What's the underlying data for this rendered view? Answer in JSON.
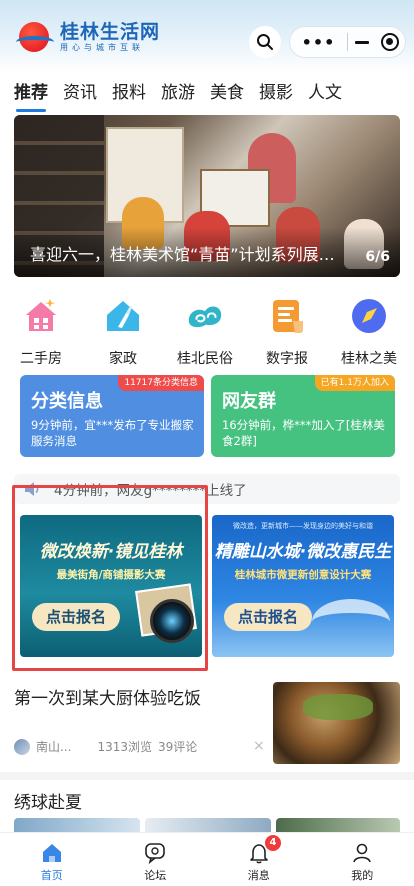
{
  "header": {
    "logo_title": "桂林生活网",
    "logo_subtitle": "用心与城市互联",
    "capsule_more": "•••"
  },
  "tabs": [
    {
      "label": "推荐",
      "active": true
    },
    {
      "label": "资讯"
    },
    {
      "label": "报料"
    },
    {
      "label": "旅游"
    },
    {
      "label": "美食"
    },
    {
      "label": "摄影"
    },
    {
      "label": "人文"
    }
  ],
  "banner": {
    "caption": "喜迎六一，桂林美术馆“青苗”计划系列展…",
    "counter": "6/6"
  },
  "categories": [
    {
      "label": "二手房",
      "icon": "house-icon",
      "color": "#f46aa0"
    },
    {
      "label": "家政",
      "icon": "broom-icon",
      "color": "#3bb6e8"
    },
    {
      "label": "桂北民俗",
      "icon": "cloud-pattern-icon",
      "color": "#2bb3c9"
    },
    {
      "label": "数字报",
      "icon": "newspaper-icon",
      "color": "#f0902a"
    },
    {
      "label": "桂林之美",
      "icon": "compass-icon",
      "color": "#4f6cf0"
    }
  ],
  "cards": {
    "classified": {
      "title": "分类信息",
      "tag": "11717条分类信息",
      "desc": "9分钟前，宜***发布了专业搬家服务消息"
    },
    "group": {
      "title": "网友群",
      "tag": "已有1.1万人加入",
      "desc": "16分钟前，桦***加入了[桂林美食2群]"
    }
  },
  "notice": {
    "text": "4分钟前，网友g********上线了"
  },
  "promos": [
    {
      "title": "微改焕新·镜见桂林",
      "subtitle": "最美街角/商铺摄影大赛",
      "button": "点击报名"
    },
    {
      "top_text": "微改造，更新城市——发现身边的美好与和谐",
      "title": "精雕山水城·微改惠民生",
      "subtitle": "桂林城市微更新创意设计大赛",
      "button": "点击报名"
    }
  ],
  "article": {
    "title": "第一次到某大厨体验吃饭",
    "source": "南山...",
    "views": "1313浏览",
    "comments": "39评论",
    "close": "×"
  },
  "section": {
    "title": "绣球赴夏"
  },
  "tabbar": [
    {
      "label": "首页",
      "icon": "home-icon",
      "active": true
    },
    {
      "label": "论坛",
      "icon": "forum-icon"
    },
    {
      "label": "消息",
      "icon": "bell-icon",
      "badge": "4"
    },
    {
      "label": "我的",
      "icon": "user-icon"
    }
  ],
  "colors": {
    "accent": "#2a7be0",
    "card_blue": "#4f8ee0",
    "card_green": "#45c280",
    "highlight_border": "#e54545"
  }
}
